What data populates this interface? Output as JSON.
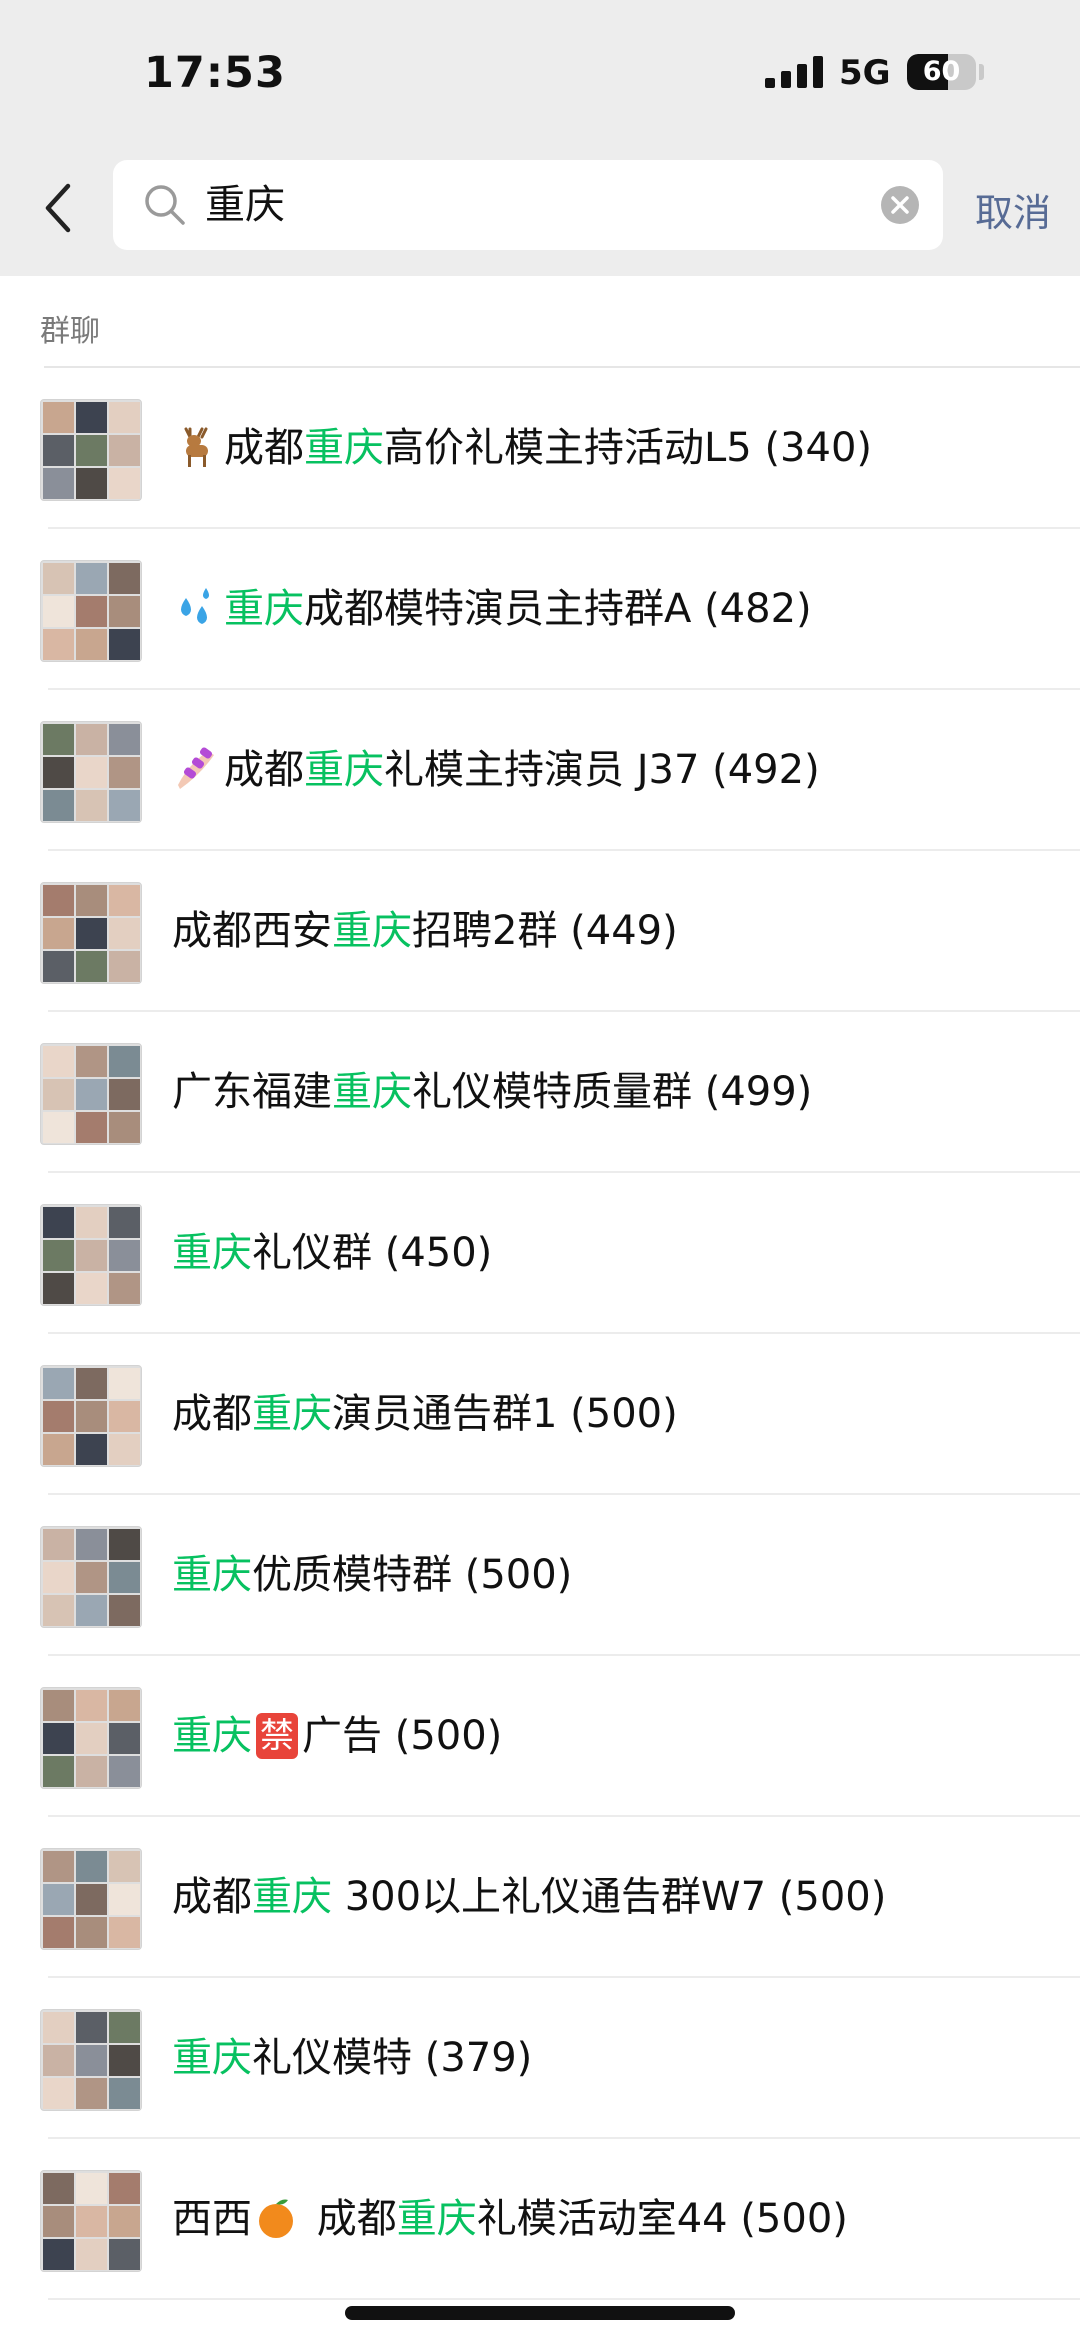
{
  "status_bar": {
    "time": "17:53",
    "network": "5G",
    "battery_level": "60"
  },
  "search": {
    "query": "重庆",
    "cancel_label": "取消"
  },
  "section_label": "群聊",
  "highlight_color": "#07c160",
  "results": [
    {
      "emoji": "deer",
      "pre": "成都",
      "hl": "重庆",
      "post": "高价礼模主持活动L5 (340)"
    },
    {
      "emoji": "sweat-droplets",
      "pre": "",
      "hl": "重庆",
      "post": "成都模特演员主持群A (482)"
    },
    {
      "emoji": "nail-polish",
      "pre": "成都",
      "hl": "重庆",
      "post": "礼模主持演员 J37 (492)"
    },
    {
      "emoji": "",
      "pre": "成都西安",
      "hl": "重庆",
      "post": "招聘2群 (449)"
    },
    {
      "emoji": "",
      "pre": "广东福建",
      "hl": "重庆",
      "post": "礼仪模特质量群 (499)"
    },
    {
      "emoji": "",
      "pre": "",
      "hl": "重庆",
      "post": "礼仪群 (450)"
    },
    {
      "emoji": "",
      "pre": "成都",
      "hl": "重庆",
      "post": "演员通告群1 (500)"
    },
    {
      "emoji": "",
      "pre": "",
      "hl": "重庆",
      "post": "优质模特群 (500)"
    },
    {
      "emoji": "",
      "pre": "",
      "hl": "重庆",
      "post_emoji": "prohibited-kanji",
      "post_emoji_text": "禁",
      "post": "广告 (500)"
    },
    {
      "emoji": "",
      "pre": "成都",
      "hl": "重庆",
      "post": " 300以上礼仪通告群W7 (500)"
    },
    {
      "emoji": "",
      "pre": "",
      "hl": "重庆",
      "post": "礼仪模特 (379)"
    },
    {
      "emoji": "",
      "pre_a": "西西",
      "mid_emoji": "tangerine",
      "pre": " 成都",
      "hl": "重庆",
      "post": "礼模活动室44 (500)"
    }
  ]
}
